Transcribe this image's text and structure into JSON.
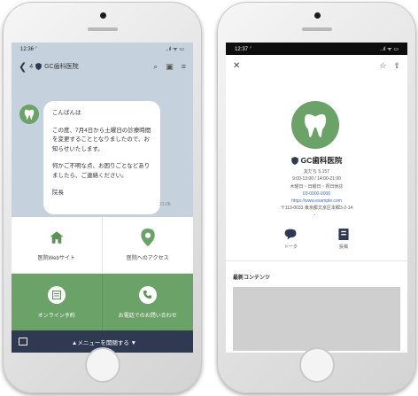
{
  "left_phone": {
    "status": {
      "time": "12:36 ᐟ",
      "indicators": "..ıl ᯤ ▭"
    },
    "header": {
      "back_count": "4",
      "title": "GC歯科医院",
      "back_glyph": "❮"
    },
    "message": {
      "paragraphs": [
        "こんばんは",
        "この度、7月4日から土曜日の診療時間を変更することとなりましたので、お知らせいたします。",
        "何かご不明な点、お困りごとなどありましたら、ご連絡ください。",
        "院長"
      ],
      "time": "21:06"
    },
    "menu": {
      "items": [
        {
          "label": "医院Webサイト",
          "icon": "house-icon"
        },
        {
          "label": "医院へのアクセス",
          "icon": "map-pin-icon"
        },
        {
          "label": "オンライン予約",
          "icon": "calendar-icon"
        },
        {
          "label": "お電話でのお問い合わせ",
          "icon": "phone-icon"
        }
      ],
      "bar_label": "▲メニューを開閉する ▼"
    }
  },
  "right_phone": {
    "status": {
      "time": "12:37 ᐟ",
      "indicators": "..ıl ᯤ ▭"
    },
    "header": {
      "close": "✕",
      "star": "☆",
      "share": "⇪"
    },
    "profile": {
      "name": "GC歯科医院",
      "lines": [
        "友だち 5,157",
        "9:00-13:00 / 14:00-21:00",
        "木曜日・日曜日・祝日休診",
        "03-0000-0000",
        "https://www.example.com",
        "〒113-0033 東京都文京区本郷3-2-14"
      ],
      "caret": "⌄"
    },
    "actions": [
      {
        "label": "トーク",
        "icon": "chat-icon"
      },
      {
        "label": "投稿",
        "icon": "post-icon"
      }
    ],
    "section_title": "最新コンテンツ"
  },
  "colors": {
    "brand_green": "#6aa267",
    "navy": "#2f3a52",
    "chat_bg": "#c5d2dd",
    "link": "#3f6fc6"
  }
}
